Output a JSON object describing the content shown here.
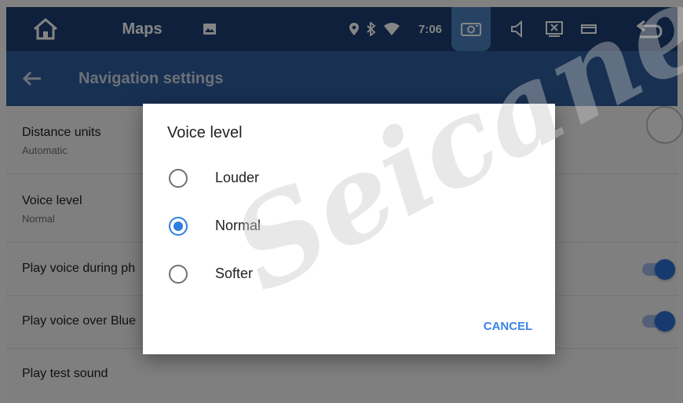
{
  "status_bar": {
    "app_title": "Maps",
    "time": "7:06",
    "icons": [
      "home-icon",
      "image-icon",
      "location-icon",
      "bluetooth-icon",
      "wifi-icon",
      "camera-icon",
      "volume-icon",
      "screen-close-icon",
      "window-icon",
      "back-arrow-icon"
    ]
  },
  "app_bar": {
    "title": "Navigation settings"
  },
  "settings": {
    "distance_units": {
      "label": "Distance units",
      "value": "Automatic"
    },
    "voice_level": {
      "label": "Voice level",
      "value": "Normal"
    },
    "play_voice_during_phone": {
      "label": "Play voice during ph",
      "enabled": true
    },
    "play_voice_over_bluetooth": {
      "label": "Play voice over Blue",
      "enabled": true
    },
    "play_test_sound": {
      "label": "Play test sound"
    }
  },
  "dialog": {
    "title": "Voice level",
    "options": [
      {
        "label": "Louder",
        "selected": false
      },
      {
        "label": "Normal",
        "selected": true
      },
      {
        "label": "Softer",
        "selected": false
      }
    ],
    "cancel_label": "CANCEL"
  },
  "watermark": "Seicane",
  "colors": {
    "status_bar": "#1b3e71",
    "app_bar": "#2f5d9d",
    "accent": "#2f7de1",
    "toggle_on": "#2b6fd3"
  }
}
